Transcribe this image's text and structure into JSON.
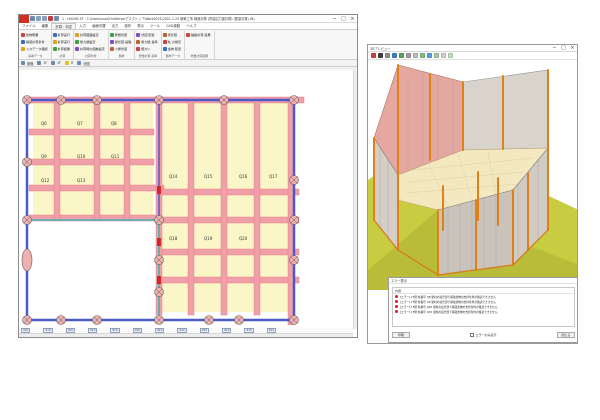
{
  "main_window": {
    "title": "1 - HOUSE-ST - C:\\Users\\user\\OneDrive\\デスクトップ\\Work2021\\2021-1-23 新築工事 構造計算 (許容応力度計算) (壁量計算).(N)",
    "controls": {
      "minimize": "─",
      "maximize": "□",
      "close": "×"
    }
  },
  "menu": [
    "ファイル",
    "編集",
    "計算・判定",
    "入力",
    "画面切替",
    "出力",
    "操作",
    "表示",
    "ツール",
    "CAD連動",
    "ヘルプ"
  ],
  "menu_active_index": 2,
  "ribbon_groups": [
    {
      "label": "基本データ",
      "items": [
        "建物概要",
        "構造計算条件",
        "入力データ確認"
      ]
    },
    {
      "label": "計算",
      "items": [
        "計算実行",
        "計算実行",
        "計算結果"
      ]
    },
    {
      "label": "計算条件",
      "items": [
        "計算範囲設定",
        "耐力壁設定",
        "計算時の個数設定"
      ]
    },
    {
      "label": "部材",
      "items": [
        "屋根伏図",
        "梁伏図 基礎",
        "小屋伏図"
      ]
    },
    {
      "label": "壁量計算 基準",
      "items": [
        "伏図 配置",
        "耐力壁 基準",
        "筋かい"
      ]
    },
    {
      "label": "部材データ",
      "items": [
        "床伏図",
        "柱 の検定",
        "金物 配置"
      ]
    },
    {
      "label": "壁量計算結果",
      "items": [
        "軸組計算 結果"
      ]
    }
  ],
  "sub_toolbar": [
    "基礎",
    "1F",
    "2F",
    "R",
    "伏図"
  ],
  "dimension_tags": [
    "910",
    "910",
    "910",
    "910",
    "910",
    "910",
    "910",
    "910",
    "910",
    "910",
    "910",
    "910"
  ],
  "plan_labels": [
    "Q6",
    "Q7",
    "Q8",
    "Q9",
    "Q10",
    "Q11",
    "Q12",
    "Q13",
    "Q14",
    "Q15",
    "Q16",
    "Q17",
    "Q18",
    "Q19",
    "Q20"
  ],
  "view3d": {
    "title": "3Dプレビュー",
    "toolbar_icon_colors": [
      "#d04040",
      "#404040",
      "#909090",
      "#4080c0",
      "#60a060",
      "#a0a0a0",
      "#c0c0c0",
      "#80c080",
      "#60a0e0",
      "#a0d0a0",
      "#d0d0d0",
      "#c0e0c0"
    ]
  },
  "message_panel": {
    "title": "エラー表示",
    "header": "内容",
    "messages": [
      "[エラー] 1F階 柱番号 Q8 梁材の接合部で補強金物の支持条件が確認できません",
      "[エラー] 1F階 柱番号 Q9 梁材の接合部で補強金物の支持条件が確認できません",
      "[エラー] 1F階 柱番号 Q10 梁材の接合部で補強金物の支持条件が確認できません",
      "[エラー] 1F階 柱番号 Q15 梁材の接合部で補強金物の支持条件が確認できません"
    ],
    "print_button": "印刷",
    "checkbox_label": "エラーのみ表示",
    "close_button": "閉じる"
  },
  "colors": {
    "beam_pink": "#f0a0a8",
    "beam_dark": "#e07080",
    "floor_yellow": "#fbf6c8",
    "outer_wall_blue": "#4a5ac8",
    "wall_teal": "#5ab0b0",
    "scene_grass": "#c8cc40",
    "post_orange": "#e08018"
  }
}
